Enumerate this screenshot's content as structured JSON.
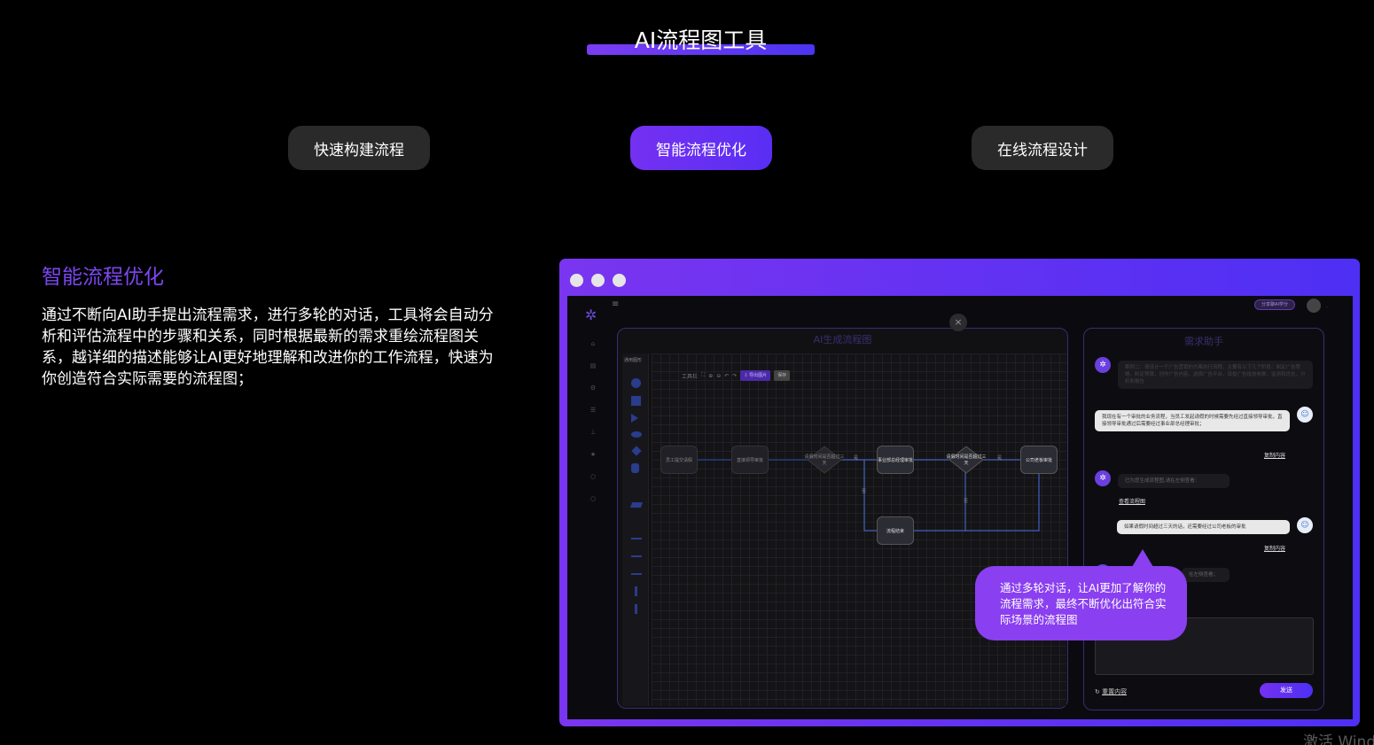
{
  "header": {
    "title": "AI流程图工具"
  },
  "tabs": [
    {
      "label": "快速构建流程",
      "active": false
    },
    {
      "label": "智能流程优化",
      "active": true
    },
    {
      "label": "在线流程设计",
      "active": false
    }
  ],
  "section": {
    "title": "智能流程优化",
    "description": "通过不断向AI助手提出流程需求，进行多轮的对话，工具将会自动分析和评估流程中的步骤和关系，同时根据最新的需求重绘流程图关系，越详细的描述能够让AI更好地理解和改进你的工作流程，快速为你创造符合实际需要的流程图；"
  },
  "mock_app": {
    "top_pill": "分享聊AI学分",
    "flow_panel": {
      "title": "AI生成流程图",
      "shapes_label": "通用图形",
      "toolbar": {
        "label": "工具栏",
        "export": "⇩ 导出图片",
        "save": "保存"
      },
      "nodes": [
        "员工提交请假",
        "直接领导审批",
        "请假时间是否超过三天",
        "事业部总经理审批",
        "请假时间是否超过三天",
        "公司老板审批",
        "流程结束"
      ],
      "edge_labels": {
        "yes": "是",
        "no": "否"
      }
    },
    "chat_panel": {
      "title": "需求助手",
      "bot_msg_1": "案例二：请设计一个广告营销的方案执行流程，主要有以下几个阶段：制定广告策略，制定预算，创作广告内容，选择广告平台，设投广告投放参数，监测和优化，分析和报告",
      "user_msg_1": "我现在有一个审批的业务流程，当员工发起请假的时候需要先经过直接领导审批，直接领导审批通过后需要经过事业部总经理审批；",
      "copy_1": "复制内容",
      "bot_msg_2": "已为您生成流程图,请在左侧查看：",
      "view_flow": "查看流程图",
      "user_msg_2": "如果请假时间超过三天的话，还需要经过公司老板的审批",
      "copy_2": "复制内容",
      "bot_msg_3": "在左侧查看；",
      "reset": "重置内容",
      "send": "发送"
    }
  },
  "callout": {
    "text": "通过多轮对话，让AI更加了解你的流程需求，最终不断优化出符合实际场景的流程图"
  },
  "watermark": "激活 Windows",
  "colors": {
    "accent_start": "#7431f2",
    "accent_end": "#4e2ff4",
    "callout": "#8a3ff0",
    "section_title": "#7b47f0"
  }
}
